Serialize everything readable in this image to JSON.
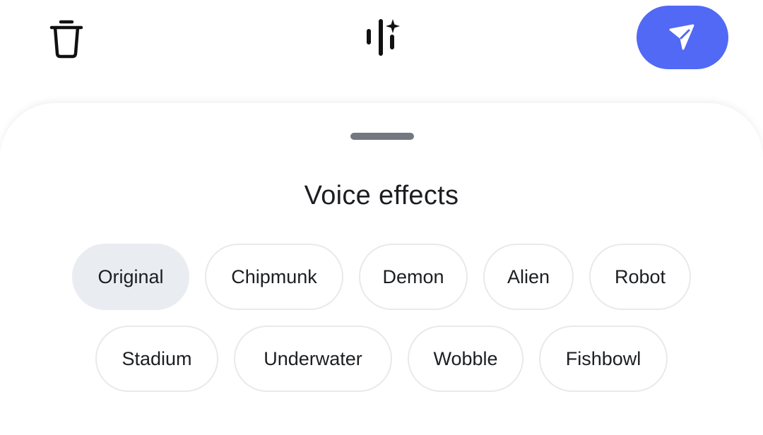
{
  "toolbar": {
    "delete_icon": "trash-icon",
    "effects_icon": "voice-effects-sparkle-icon",
    "send_icon": "send-arrow-icon",
    "accent_color": "#5169f4"
  },
  "sheet": {
    "title": "Voice effects",
    "selected": "Original",
    "effects_row1": [
      {
        "label": "Original",
        "selected": true
      },
      {
        "label": "Chipmunk",
        "selected": false
      },
      {
        "label": "Demon",
        "selected": false
      },
      {
        "label": "Alien",
        "selected": false
      },
      {
        "label": "Robot",
        "selected": false
      }
    ],
    "effects_row2": [
      {
        "label": "Stadium",
        "selected": false
      },
      {
        "label": "Underwater",
        "selected": false
      },
      {
        "label": "Wobble",
        "selected": false
      },
      {
        "label": "Fishbowl",
        "selected": false
      }
    ]
  }
}
